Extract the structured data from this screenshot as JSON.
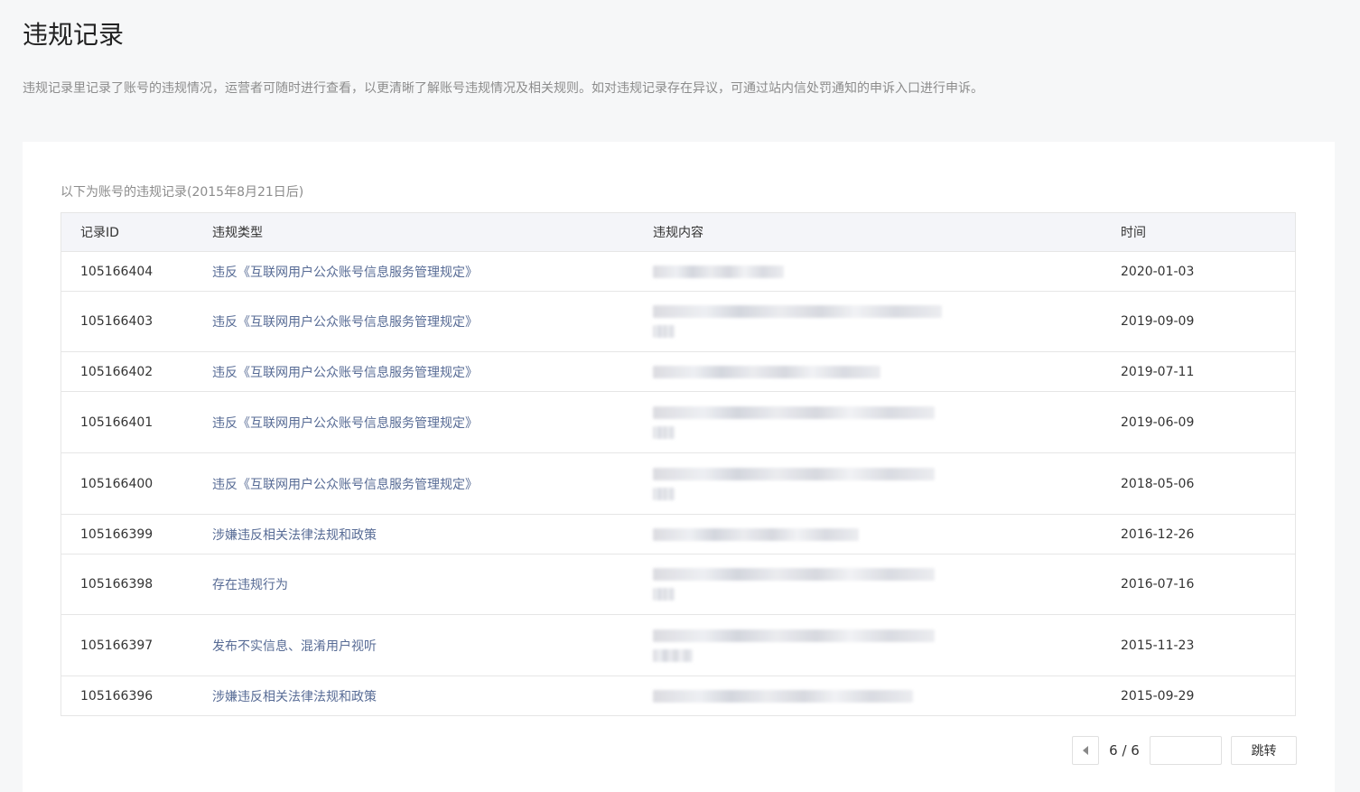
{
  "page": {
    "title": "违规记录",
    "description": "违规记录里记录了账号的违规情况，运营者可随时进行查看，以更清晰了解账号违规情况及相关规则。如对违规记录存在异议，可通过站内信处罚通知的申诉入口进行申诉。"
  },
  "records": {
    "caption": "以下为账号的违规记录(2015年8月21日后)",
    "columns": {
      "id": "记录ID",
      "type": "违规类型",
      "content": "违规内容",
      "time": "时间"
    },
    "rows": [
      {
        "id": "105166404",
        "type": "违反《互联网用户公众账号信息服务管理规定》",
        "time": "2020-01-03"
      },
      {
        "id": "105166403",
        "type": "违反《互联网用户公众账号信息服务管理规定》",
        "time": "2019-09-09"
      },
      {
        "id": "105166402",
        "type": "违反《互联网用户公众账号信息服务管理规定》",
        "time": "2019-07-11"
      },
      {
        "id": "105166401",
        "type": "违反《互联网用户公众账号信息服务管理规定》",
        "time": "2019-06-09"
      },
      {
        "id": "105166400",
        "type": "违反《互联网用户公众账号信息服务管理规定》",
        "time": "2018-05-06"
      },
      {
        "id": "105166399",
        "type": "涉嫌违反相关法律法规和政策",
        "time": "2016-12-26"
      },
      {
        "id": "105166398",
        "type": "存在违规行为",
        "time": "2016-07-16"
      },
      {
        "id": "105166397",
        "type": "发布不实信息、混淆用户视听",
        "time": "2015-11-23"
      },
      {
        "id": "105166396",
        "type": "涉嫌违反相关法律法规和政策",
        "time": "2015-09-29"
      }
    ]
  },
  "pagination": {
    "current": "6 / 6",
    "jump_input_value": "",
    "jump_label": "跳转",
    "prev_icon": "caret-left-icon"
  }
}
